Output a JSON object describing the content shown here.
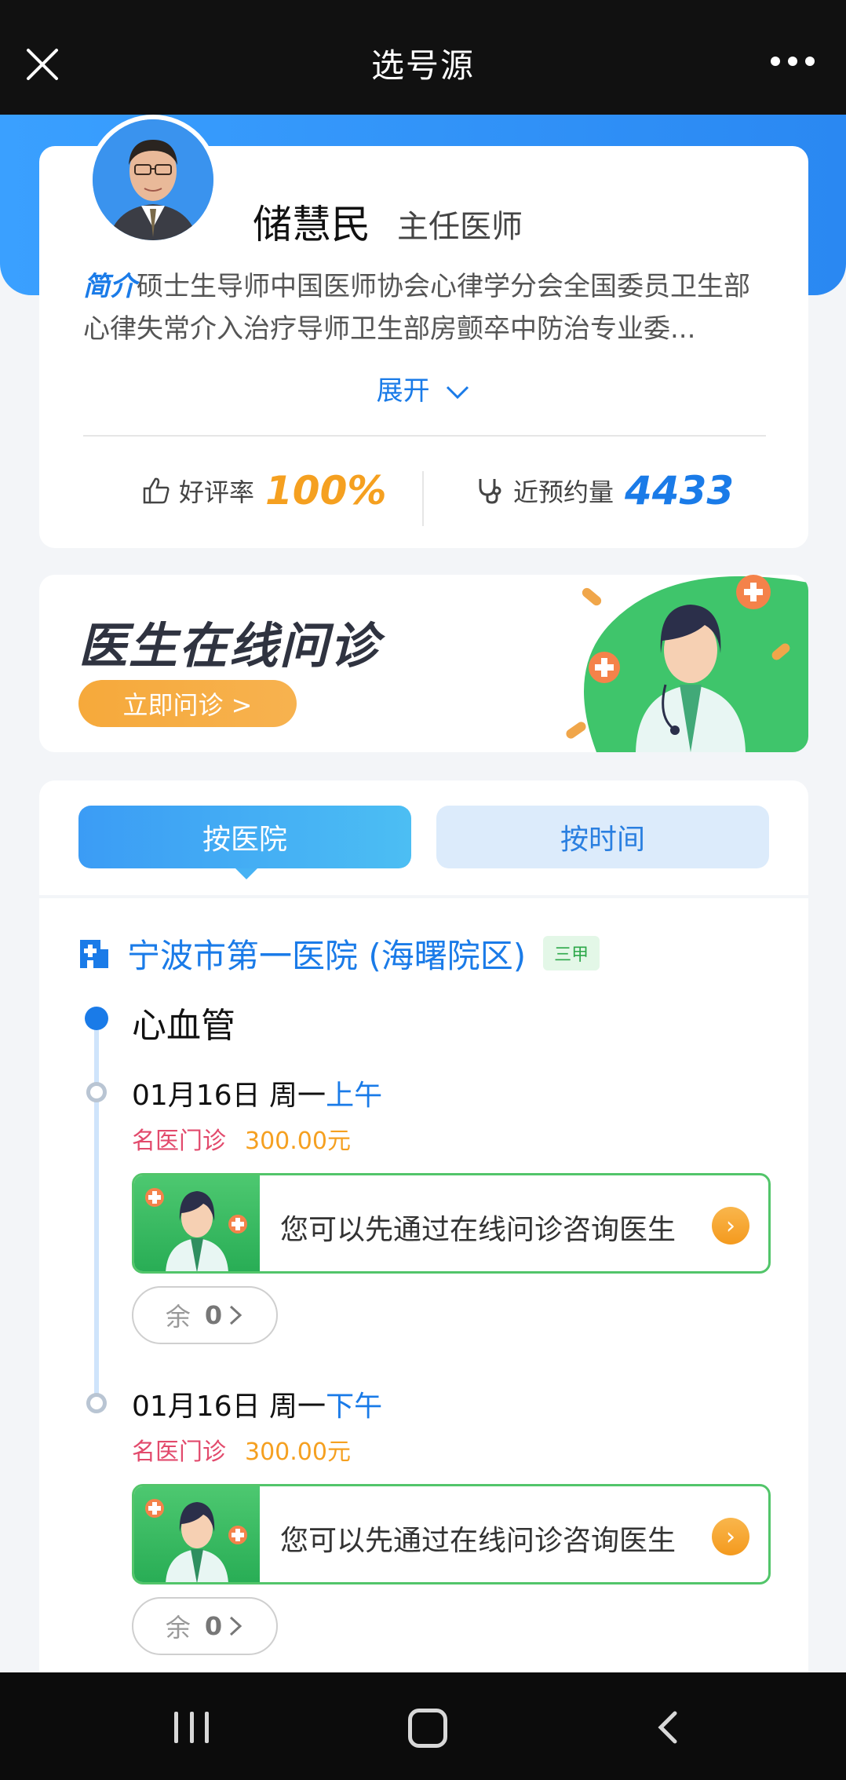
{
  "header": {
    "title": "选号源",
    "close_icon": "close-icon",
    "more_icon": "more-icon"
  },
  "doctor": {
    "name": "储慧民",
    "title": "主任医师",
    "intro_tag": "简介",
    "intro_text": "硕士生导师中国医师协会心律学分会全国委员卫生部心律失常介入治疗导师卫生部房颤卒中防治专业委...",
    "expand_label": "展开",
    "rating_label": "好评率",
    "rating_value": "100%",
    "appointments_label": "近预约量",
    "appointments_value": "4433"
  },
  "banner": {
    "title": "医生在线问诊",
    "button_label": "立即问诊 >"
  },
  "tabs": [
    {
      "label": "按医院",
      "active": true
    },
    {
      "label": "按时间",
      "active": false
    }
  ],
  "hospital": {
    "name": "宁波市第一医院 (海曙院区)",
    "badge": "三甲"
  },
  "department": "心血管",
  "slots": [
    {
      "date": "01月16日 周一",
      "ampm": "上午",
      "type": "名医门诊",
      "price": "300.00元",
      "consult_text": "您可以先通过在线问诊咨询医生",
      "remain_label": "余",
      "remain_count": "0"
    },
    {
      "date": "01月16日 周一",
      "ampm": "下午",
      "type": "名医门诊",
      "price": "300.00元",
      "consult_text": "您可以先通过在线问诊咨询医生",
      "remain_label": "余",
      "remain_count": "0"
    }
  ],
  "colors": {
    "accent": "#1a7be8",
    "orange": "#f5a020",
    "green": "#52c56a",
    "pink": "#e24a6c"
  }
}
